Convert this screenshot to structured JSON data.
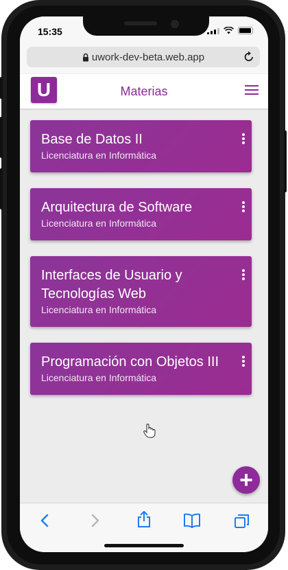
{
  "status_bar": {
    "time": "15:35"
  },
  "browser": {
    "url": "uwork-dev-beta.web.app"
  },
  "app_header": {
    "logo_letter": "U",
    "title": "Materias"
  },
  "subjects": [
    {
      "name": "Base de Datos II",
      "career": "Licenciatura en Informática"
    },
    {
      "name": "Arquitectura de Software",
      "career": "Licenciatura en Informática"
    },
    {
      "name": "Interfaces de Usuario y Tecnologías Web",
      "career": "Licenciatura en Informática"
    },
    {
      "name": "Programación con Objetos III",
      "career": "Licenciatura en Informática"
    }
  ],
  "fab": {
    "label": "+"
  },
  "colors": {
    "brand": "#8e2a9a",
    "card": "#8b3599",
    "ios_blue": "#1e7cf2",
    "disabled": "#b5b5b5"
  },
  "icons": [
    "lock-icon",
    "reload-icon",
    "hamburger-menu-icon",
    "more-vert-icon",
    "add-icon",
    "back-icon",
    "forward-icon",
    "share-icon",
    "bookmarks-icon",
    "tabs-icon",
    "hand-cursor-icon"
  ]
}
